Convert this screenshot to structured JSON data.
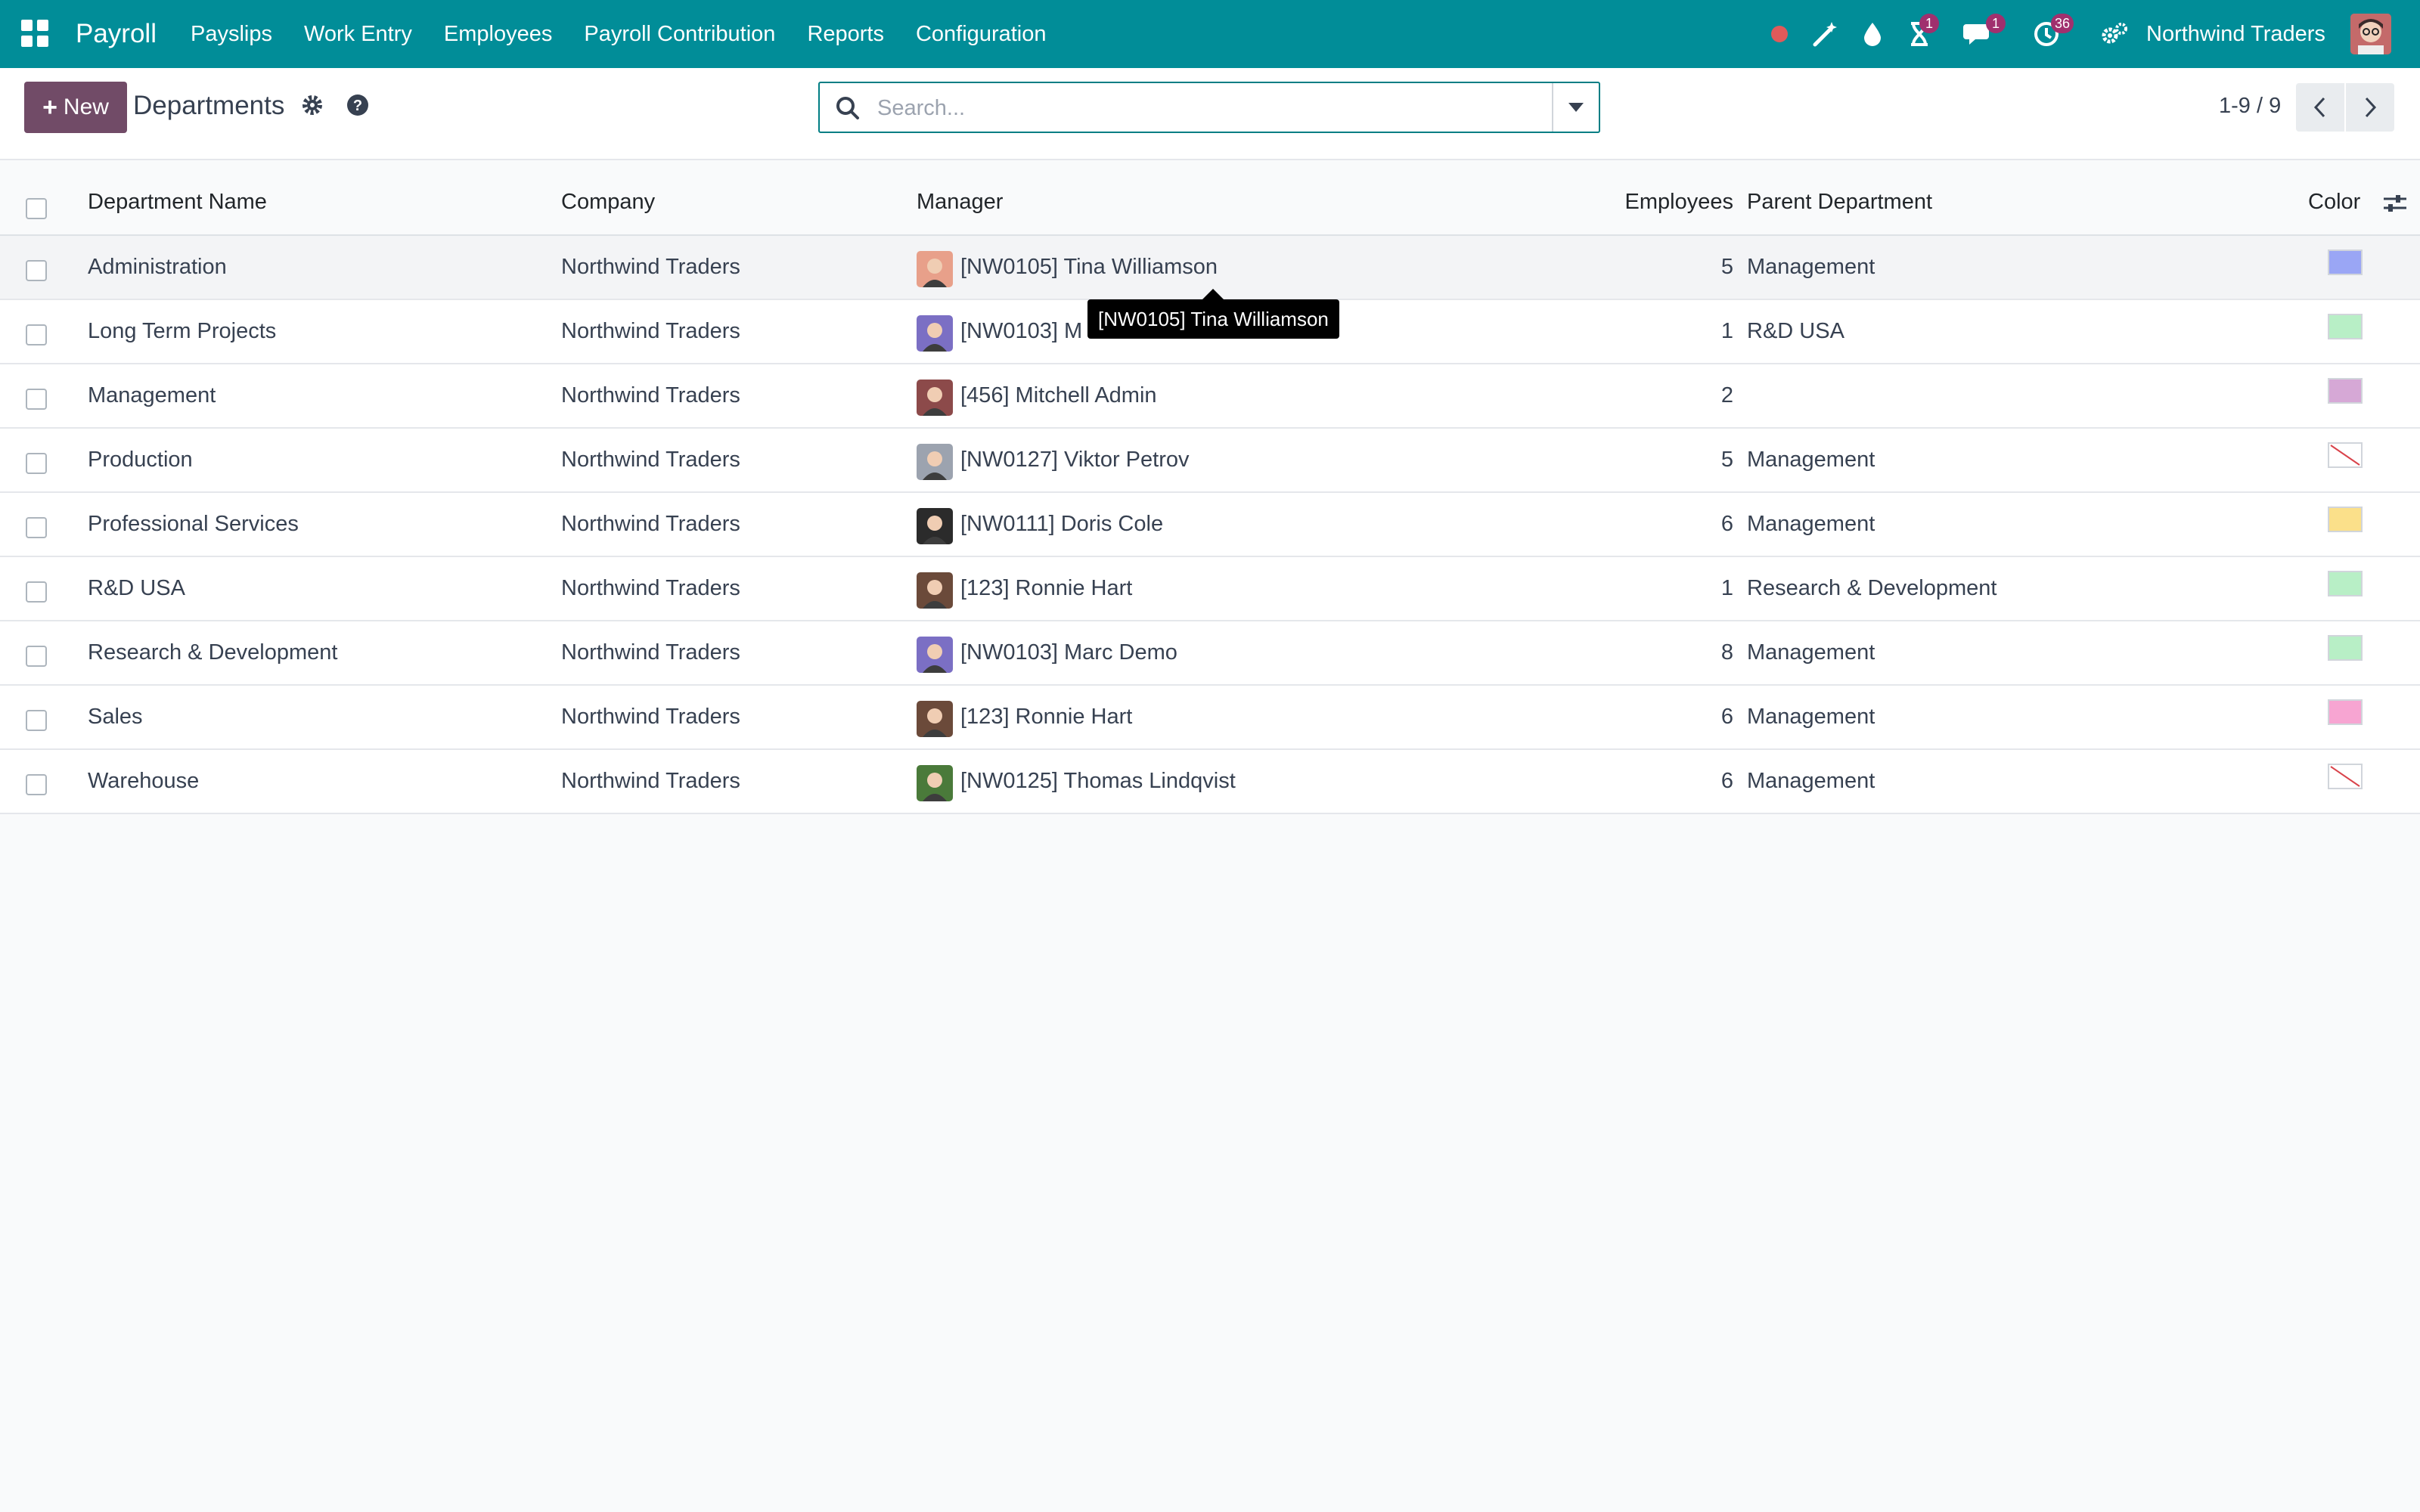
{
  "navbar": {
    "brand": "Payroll",
    "menu": [
      "Payslips",
      "Work Entry",
      "Employees",
      "Payroll Contribution",
      "Reports",
      "Configuration"
    ],
    "activity_badge": "1",
    "messages_badge": "1",
    "timer_badge": "36",
    "company": "Northwind Traders"
  },
  "control": {
    "new_label": "New",
    "title": "Departments",
    "search_placeholder": "Search...",
    "pager": "1-9 / 9"
  },
  "table": {
    "headers": {
      "name": "Department Name",
      "company": "Company",
      "manager": "Manager",
      "employees": "Employees",
      "parent": "Parent Department",
      "color": "Color"
    },
    "rows": [
      {
        "name": "Administration",
        "company": "Northwind Traders",
        "manager": "[NW0105] Tina Williamson",
        "employees": "5",
        "parent": "Management",
        "color": "#9aa6f5",
        "avatar_color": "#e8a08a"
      },
      {
        "name": "Long Term Projects",
        "company": "Northwind Traders",
        "manager": "[NW0103] M",
        "employees": "1",
        "parent": "R&D USA",
        "color": "#b8efc6",
        "avatar_color": "#7b6fc4"
      },
      {
        "name": "Management",
        "company": "Northwind Traders",
        "manager": "[456] Mitchell Admin",
        "employees": "2",
        "parent": "",
        "color": "#d6a8d6",
        "avatar_color": "#8c4a4a"
      },
      {
        "name": "Production",
        "company": "Northwind Traders",
        "manager": "[NW0127] Viktor Petrov",
        "employees": "5",
        "parent": "Management",
        "color": "none",
        "avatar_color": "#9ca3af"
      },
      {
        "name": "Professional Services",
        "company": "Northwind Traders",
        "manager": "[NW0111] Doris Cole",
        "employees": "6",
        "parent": "Management",
        "color": "#fbe08a",
        "avatar_color": "#2b2b2b"
      },
      {
        "name": "R&D USA",
        "company": "Northwind Traders",
        "manager": "[123] Ronnie Hart",
        "employees": "1",
        "parent": "Research & Development",
        "color": "#b8efc6",
        "avatar_color": "#6b4a3a"
      },
      {
        "name": "Research & Development",
        "company": "Northwind Traders",
        "manager": "[NW0103] Marc Demo",
        "employees": "8",
        "parent": "Management",
        "color": "#b8efc6",
        "avatar_color": "#7b6fc4"
      },
      {
        "name": "Sales",
        "company": "Northwind Traders",
        "manager": "[123] Ronnie Hart",
        "employees": "6",
        "parent": "Management",
        "color": "#f7a5d2",
        "avatar_color": "#6b4a3a"
      },
      {
        "name": "Warehouse",
        "company": "Northwind Traders",
        "manager": "[NW0125] Thomas Lindqvist",
        "employees": "6",
        "parent": "Management",
        "color": "none",
        "avatar_color": "#4a7a3a"
      }
    ]
  },
  "tooltip": "[NW0105] Tina Williamson"
}
